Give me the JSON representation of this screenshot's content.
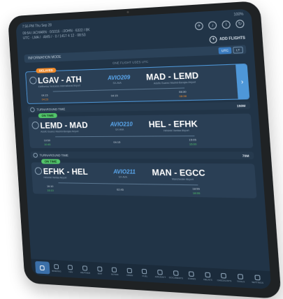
{
  "status": {
    "time": "7:56 PM",
    "date": "Thu Sep 28",
    "battery": "100%"
  },
  "header": {
    "line1": "09:54 / ACHARN · 0/1016   ·  /JOHN · 6322 / 8K",
    "line2": "UTC · LMA /  ·  AMS /  ·  0 / 1417 4 12  ·  08:53",
    "add_flight": "ADD FLIGHTS"
  },
  "info_mode": {
    "label": "INFORMATION MODE",
    "utc": "UTC",
    "lt": "LT",
    "hint": "ONE FLIGHT USES UTC"
  },
  "flights": [
    {
      "status": "DELAYED",
      "from": "LGAV - ATH",
      "from_airport": "Eleftherios Venizelos International Airport",
      "flight_no": "AVIO209",
      "reg": "SX-AVA",
      "to": "MAD - LEMD",
      "to_airport": "Adolfo Suarez Madrid-Barajas Airport",
      "dep_sched": "04:15",
      "dep_actual": "04:23",
      "block": "04:15",
      "arr_sched": "08:30",
      "arr_actual": "08:38"
    },
    {
      "status": "ON TIME",
      "from": "LEMD - MAD",
      "from_airport": "Adolfo Suarez Madrid-Barajas Airport",
      "flight_no": "AVIO210",
      "reg": "SX-AVA",
      "to": "HEL - EFHK",
      "to_airport": "Helsinki Vantaa Airport",
      "dep_sched": "10:50",
      "dep_actual": "10:45",
      "block": "04:15",
      "arr_sched": "15:05",
      "arr_actual": "15:00"
    },
    {
      "status": "ON TIME",
      "from": "EFHK - HEL",
      "from_airport": "Helsinki Vantaa Airport",
      "flight_no": "AVIO211",
      "reg": "SX-AVA",
      "to": "MAN - EGCC",
      "to_airport": "Manchester Airport",
      "dep_sched": "16:10",
      "dep_actual": "16:10",
      "block": "02:45",
      "arr_sched": "18:55",
      "arr_actual": "18:55"
    }
  ],
  "turnarounds": [
    {
      "label": "TURNAROUND TIME",
      "value": "150M"
    },
    {
      "label": "TURNAROUND TIME",
      "value": "70M"
    }
  ],
  "tabs": [
    "BRIEFING",
    "NAV",
    "WEATHER",
    "MAP",
    "NOTAM",
    "CREW",
    "FUEL",
    "AIRCRAFT",
    "DOCUMENTS",
    "FORMS",
    "DELAYS",
    "CHECKLISTS",
    "TOOLS",
    "SETTINGS"
  ]
}
